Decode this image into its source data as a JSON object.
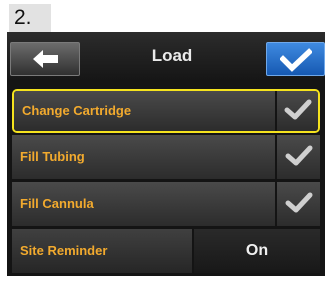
{
  "step": "2.",
  "header": {
    "title": "Load",
    "back_icon": "arrow-left-icon",
    "confirm_icon": "checkmark-icon"
  },
  "menu": [
    {
      "label": "Change Cartridge",
      "status": "completed",
      "selected": true
    },
    {
      "label": "Fill Tubing",
      "status": "completed",
      "selected": false
    },
    {
      "label": "Fill Cannula",
      "status": "completed",
      "selected": false
    }
  ],
  "site_reminder": {
    "label": "Site Reminder",
    "value": "On"
  },
  "colors": {
    "label_orange": "#f2aa2e",
    "selection_yellow": "#f5e31e",
    "confirm_blue": "#2a74cf"
  }
}
